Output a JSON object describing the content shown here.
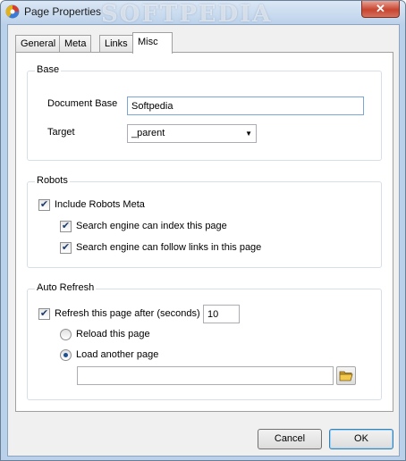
{
  "window": {
    "title": "Page Properties",
    "watermark": "SOFTPEDIA",
    "close_glyph": "✕",
    "icon": "page-properties-icon"
  },
  "tabs": [
    {
      "label": "General",
      "active": false
    },
    {
      "label": "Meta",
      "active": false
    },
    {
      "label": "Links",
      "active": false
    },
    {
      "label": "Misc",
      "active": true
    }
  ],
  "base": {
    "title": "Base",
    "document_base_label": "Document Base",
    "document_base_value": "Softpedia",
    "target_label": "Target",
    "target_value": "_parent"
  },
  "robots": {
    "title": "Robots",
    "include_meta": {
      "label": "Include Robots Meta",
      "checked": true
    },
    "can_index": {
      "label": "Search engine can index this page",
      "checked": true
    },
    "can_follow": {
      "label": "Search engine can follow links in this page",
      "checked": true
    }
  },
  "auto_refresh": {
    "title": "Auto Refresh",
    "refresh": {
      "label": "Refresh this page after (seconds)",
      "checked": true
    },
    "seconds_value": "10",
    "reload_option": {
      "label": "Reload this page",
      "selected": false
    },
    "load_option": {
      "label": "Load another page",
      "selected": true
    },
    "page_url_value": ""
  },
  "buttons": {
    "cancel": "Cancel",
    "ok": "OK"
  },
  "colors": {
    "frame": "#b9d1ea",
    "dialog_bg": "#f0f0f0",
    "accent_border": "#7aa7d8"
  }
}
